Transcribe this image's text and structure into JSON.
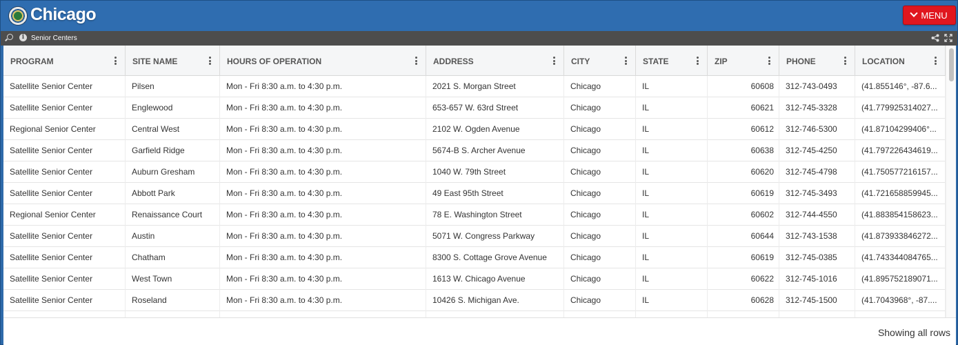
{
  "header": {
    "brand": "Chicago",
    "menu_label": "MENU"
  },
  "subbar": {
    "dataset_name": "Senior Centers"
  },
  "icons": {
    "seal": "chicago-seal-icon",
    "menu": "chevron-down-icon",
    "search": "search-icon",
    "info": "info-icon",
    "share": "share-icon",
    "expand": "expand-icon",
    "column_menu": "kebab-icon"
  },
  "colors": {
    "header_bg": "#2f6db0",
    "menu_button": "#e0161e",
    "subbar_bg": "#4d4d4d"
  },
  "table": {
    "columns": [
      "PROGRAM",
      "SITE NAME",
      "HOURS OF OPERATION",
      "ADDRESS",
      "CITY",
      "STATE",
      "ZIP",
      "PHONE",
      "LOCATION"
    ],
    "rows": [
      [
        "Satellite Senior Center",
        "Pilsen",
        "Mon - Fri 8:30 a.m. to 4:30 p.m.",
        "2021 S. Morgan Street",
        "Chicago",
        "IL",
        "60608",
        "312-743-0493",
        "(41.855146°, -87.6..."
      ],
      [
        "Satellite Senior Center",
        "Englewood",
        "Mon - Fri 8:30 a.m. to 4:30 p.m.",
        "653-657 W. 63rd Street",
        "Chicago",
        "IL",
        "60621",
        "312-745-3328",
        "(41.779925314027..."
      ],
      [
        "Regional Senior Center",
        "Central West",
        "Mon - Fri 8:30 a.m. to 4:30 p.m.",
        "2102 W. Ogden Avenue",
        "Chicago",
        "IL",
        "60612",
        "312-746-5300",
        "(41.87104299406°..."
      ],
      [
        "Satellite Senior Center",
        "Garfield Ridge",
        "Mon - Fri 8:30 a.m. to 4:30 p.m.",
        "5674-B S. Archer Avenue",
        "Chicago",
        "IL",
        "60638",
        "312-745-4250",
        "(41.797226434619..."
      ],
      [
        "Satellite Senior Center",
        "Auburn Gresham",
        "Mon - Fri 8:30 a.m. to 4:30 p.m.",
        "1040 W. 79th Street",
        "Chicago",
        "IL",
        "60620",
        "312-745-4798",
        "(41.750577216157..."
      ],
      [
        "Satellite Senior Center",
        "Abbott Park",
        "Mon - Fri 8:30 a.m. to 4:30 p.m.",
        "49 East 95th Street",
        "Chicago",
        "IL",
        "60619",
        "312-745-3493",
        "(41.721658859945..."
      ],
      [
        "Regional Senior Center",
        "Renaissance Court",
        "Mon - Fri 8:30 a.m. to 4:30 p.m.",
        "78 E. Washington Street",
        "Chicago",
        "IL",
        "60602",
        "312-744-4550",
        "(41.883854158623..."
      ],
      [
        "Satellite Senior Center",
        "Austin",
        "Mon - Fri 8:30 a.m. to 4:30 p.m.",
        "5071 W. Congress Parkway",
        "Chicago",
        "IL",
        "60644",
        "312-743-1538",
        "(41.873933846272..."
      ],
      [
        "Satellite Senior Center",
        "Chatham",
        "Mon - Fri 8:30 a.m. to 4:30 p.m.",
        "8300 S. Cottage Grove Avenue",
        "Chicago",
        "IL",
        "60619",
        "312-745-0385",
        "(41.743344084765..."
      ],
      [
        "Satellite Senior Center",
        "West Town",
        "Mon - Fri 8:30 a.m. to 4:30 p.m.",
        "1613 W. Chicago Avenue",
        "Chicago",
        "IL",
        "60622",
        "312-745-1016",
        "(41.895752189071..."
      ],
      [
        "Satellite Senior Center",
        "Roseland",
        "Mon - Fri 8:30 a.m. to 4:30 p.m.",
        "10426 S. Michigan Ave.",
        "Chicago",
        "IL",
        "60628",
        "312-745-1500",
        "(41.7043968°, -87...."
      ]
    ]
  },
  "footer": {
    "row_status": "Showing all rows"
  }
}
